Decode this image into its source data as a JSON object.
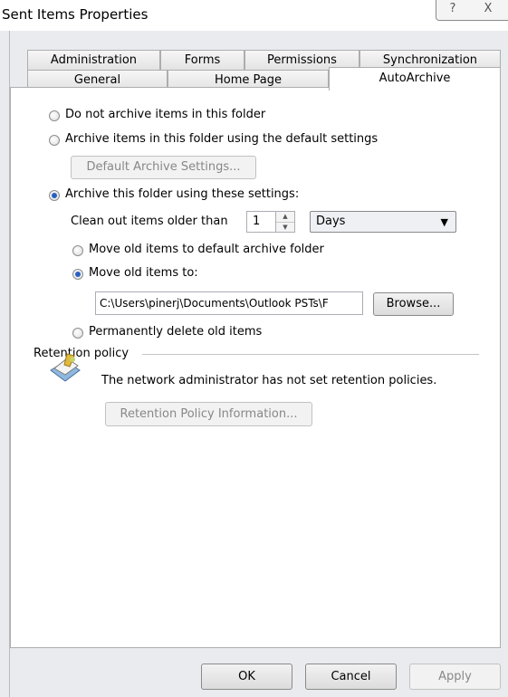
{
  "window": {
    "title": "Sent Items Properties",
    "help_glyph": "?",
    "close_glyph": "X"
  },
  "tabs": {
    "row_back": [
      "Administration",
      "Forms",
      "Permissions",
      "Synchronization"
    ],
    "row_front": [
      "General",
      "Home Page",
      "AutoArchive"
    ],
    "active": "AutoArchive"
  },
  "autoarchive": {
    "option_none": "Do not archive items in this folder",
    "option_default": "Archive items in this folder using the default settings",
    "default_settings_button": "Default Archive Settings...",
    "option_custom": "Archive this folder using these settings:",
    "clean_out_label": "Clean out items older than",
    "clean_out_value": "1",
    "unit_value": "Days",
    "move_default_label": "Move old items to default archive folder",
    "move_to_label": "Move old items to:",
    "path_value": "C:\\Users\\pinerj\\Documents\\Outlook PSTs\\F",
    "browse_button": "Browse...",
    "delete_label": "Permanently delete old items",
    "selected": [
      "Archive this folder using these settings:",
      "Move old items to:"
    ]
  },
  "retention": {
    "header": "Retention policy",
    "message": "The network administrator has not set retention policies.",
    "info_button": "Retention Policy Information..."
  },
  "footer": {
    "ok": "OK",
    "cancel": "Cancel",
    "apply": "Apply"
  }
}
